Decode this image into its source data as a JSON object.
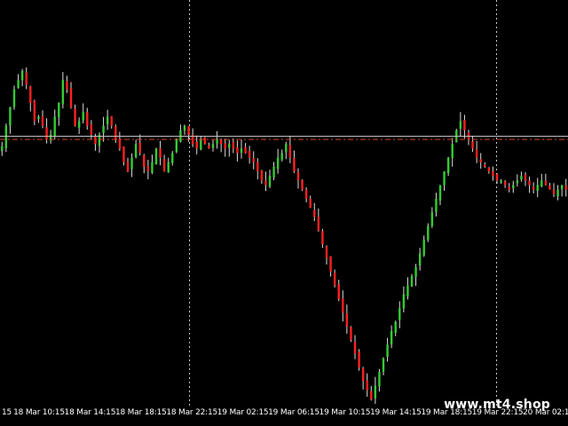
{
  "chart": {
    "background": "#000000",
    "bull_color": "#33cc33",
    "bear_color": "#ff2020",
    "wick_color": "#dddddd",
    "grid_color": "#c8c8c8",
    "bid_line_color": "#c0c0c0",
    "ask_line_color": "#d04020"
  },
  "chart_data": {
    "type": "candlestick",
    "y_levels": {
      "bid": 0.578,
      "ask": 0.571
    },
    "vertical_grid_x": [
      0.333,
      0.873
    ],
    "closes": [
      0.555,
      0.6,
      0.64,
      0.68,
      0.7,
      0.72,
      0.69,
      0.65,
      0.61,
      0.62,
      0.6,
      0.57,
      0.58,
      0.62,
      0.65,
      0.7,
      0.68,
      0.64,
      0.6,
      0.61,
      0.63,
      0.6,
      0.58,
      0.56,
      0.58,
      0.6,
      0.62,
      0.6,
      0.57,
      0.55,
      0.52,
      0.5,
      0.53,
      0.56,
      0.54,
      0.51,
      0.5,
      0.52,
      0.55,
      0.53,
      0.5,
      0.52,
      0.54,
      0.57,
      0.59,
      0.6,
      0.58,
      0.56,
      0.55,
      0.57,
      0.56,
      0.55,
      0.56,
      0.57,
      0.56,
      0.55,
      0.56,
      0.55,
      0.54,
      0.55,
      0.54,
      0.53,
      0.52,
      0.5,
      0.48,
      0.47,
      0.49,
      0.51,
      0.53,
      0.54,
      0.56,
      0.53,
      0.5,
      0.48,
      0.46,
      0.44,
      0.42,
      0.4,
      0.37,
      0.34,
      0.31,
      0.28,
      0.25,
      0.22,
      0.19,
      0.16,
      0.13,
      0.1,
      0.07,
      0.04,
      0.02,
      0.0,
      0.03,
      0.06,
      0.09,
      0.12,
      0.15,
      0.17,
      0.2,
      0.23,
      0.25,
      0.27,
      0.29,
      0.32,
      0.35,
      0.38,
      0.41,
      0.44,
      0.47,
      0.5,
      0.53,
      0.56,
      0.59,
      0.61,
      0.59,
      0.57,
      0.55,
      0.53,
      0.52,
      0.51,
      0.5,
      0.49,
      0.48,
      0.48,
      0.47,
      0.46,
      0.47,
      0.48,
      0.49,
      0.48,
      0.47,
      0.46,
      0.47,
      0.48,
      0.47,
      0.46,
      0.45,
      0.46,
      0.47,
      0.46
    ],
    "y_range": [
      0.0,
      0.72
    ],
    "x_ticks": [
      "15",
      "18 Mar 10:15",
      "18 Mar 14:15",
      "18 Mar 18:15",
      "18 Mar 22:15",
      "19 Mar 02:15",
      "19 Mar 06:15",
      "19 Mar 10:15",
      "19 Mar 14:15",
      "19 Mar 18:15",
      "19 Mar 22:15",
      "20 Mar 02:15"
    ]
  },
  "watermark": "www.mt4.shop"
}
